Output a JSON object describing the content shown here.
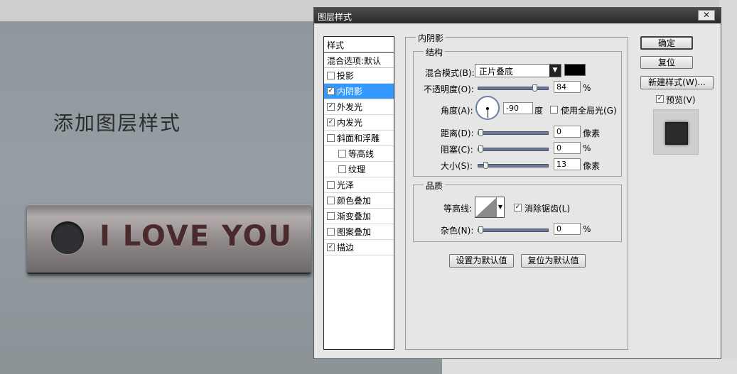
{
  "canvas": {
    "title": "添加图层样式",
    "button_text": "I LOVE YOU"
  },
  "dialog": {
    "title": "图层样式",
    "close_glyph": "✕",
    "styles_header": "样式",
    "blend_options": "混合选项:默认",
    "styles": [
      {
        "label": "投影",
        "checked": false,
        "selected": false,
        "sub": false
      },
      {
        "label": "内阴影",
        "checked": true,
        "selected": true,
        "sub": false
      },
      {
        "label": "外发光",
        "checked": true,
        "selected": false,
        "sub": false
      },
      {
        "label": "内发光",
        "checked": true,
        "selected": false,
        "sub": false
      },
      {
        "label": "斜面和浮雕",
        "checked": false,
        "selected": false,
        "sub": false
      },
      {
        "label": "等高线",
        "checked": false,
        "selected": false,
        "sub": true
      },
      {
        "label": "纹理",
        "checked": false,
        "selected": false,
        "sub": true
      },
      {
        "label": "光泽",
        "checked": false,
        "selected": false,
        "sub": false
      },
      {
        "label": "颜色叠加",
        "checked": false,
        "selected": false,
        "sub": false
      },
      {
        "label": "渐变叠加",
        "checked": false,
        "selected": false,
        "sub": false
      },
      {
        "label": "图案叠加",
        "checked": false,
        "selected": false,
        "sub": false
      },
      {
        "label": "描边",
        "checked": true,
        "selected": false,
        "sub": false
      }
    ],
    "panel_title": "内阴影",
    "structure": {
      "title": "结构",
      "blend_mode_label": "混合模式(B):",
      "blend_mode_value": "正片叠底",
      "blend_color": "#000000",
      "opacity_label": "不透明度(O):",
      "opacity_value": "84",
      "opacity_unit": "%",
      "opacity_fraction": 0.84,
      "angle_label": "角度(A):",
      "angle_value": "-90",
      "angle_unit": "度",
      "global_light_label": "使用全局光(G)",
      "global_light_checked": false,
      "distance_label": "距离(D):",
      "distance_value": "0",
      "distance_unit": "像素",
      "distance_fraction": 0,
      "choke_label": "阻塞(C):",
      "choke_value": "0",
      "choke_unit": "%",
      "choke_fraction": 0,
      "size_label": "大小(S):",
      "size_value": "13",
      "size_unit": "像素",
      "size_fraction": 0.08
    },
    "quality": {
      "title": "品质",
      "contour_label": "等高线:",
      "antialias_label": "消除锯齿(L)",
      "antialias_checked": true,
      "noise_label": "杂色(N):",
      "noise_value": "0",
      "noise_unit": "%",
      "noise_fraction": 0
    },
    "set_default": "设置为默认值",
    "reset_default": "复位为默认值",
    "ok": "确定",
    "reset": "复位",
    "new_style": "新建样式(W)...",
    "preview_label": "预览(V)",
    "preview_checked": true
  }
}
